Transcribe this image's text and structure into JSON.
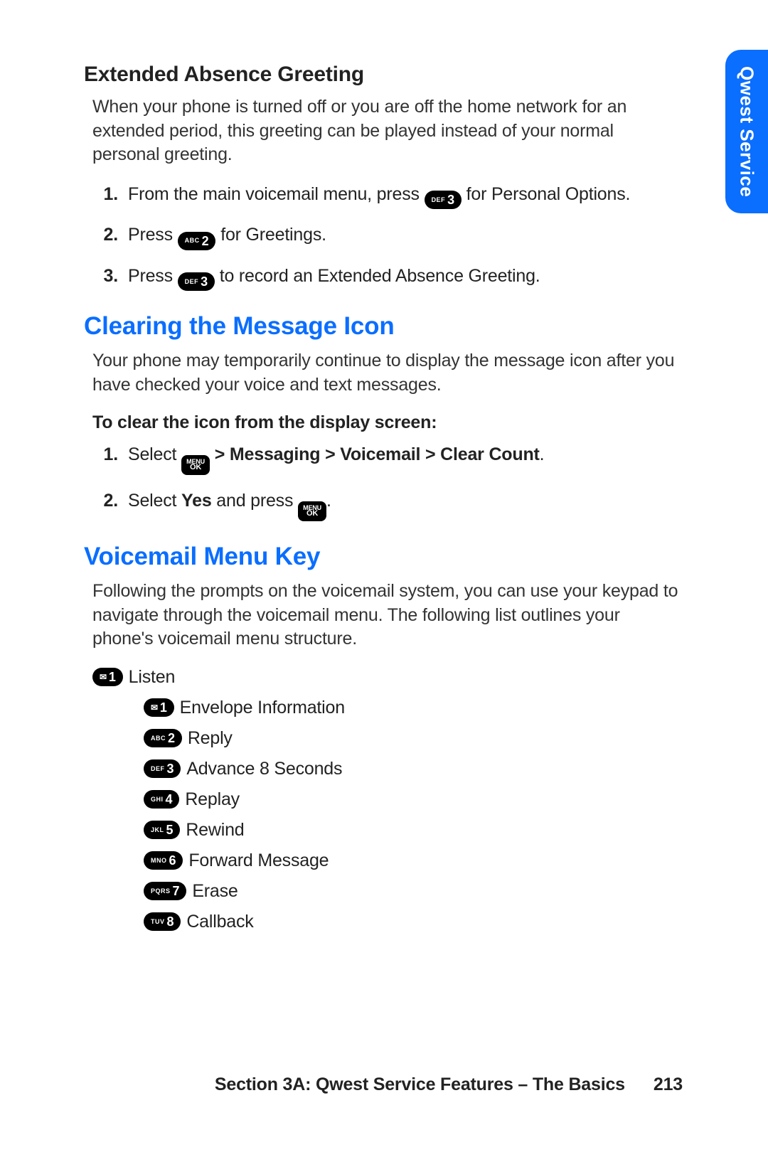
{
  "tab": "Qwest Service",
  "sections": {
    "extended": {
      "heading": "Extended Absence Greeting",
      "intro": "When your phone is turned off or you are off the home network for an extended period, this greeting can be played instead of your normal personal greeting.",
      "steps": [
        {
          "pre": "From the main voicemail menu, press ",
          "key": {
            "sm": "DEF",
            "big": "3"
          },
          "post": " for Personal Options."
        },
        {
          "pre": "Press ",
          "key": {
            "sm": "ABC",
            "big": "2"
          },
          "post": " for Greetings."
        },
        {
          "pre": "Press ",
          "key": {
            "sm": "DEF",
            "big": "3"
          },
          "post": " to record an Extended Absence Greeting."
        }
      ]
    },
    "clearing": {
      "heading": "Clearing the Message Icon",
      "intro": "Your phone may temporarily continue to display the message icon after you have checked your voice and text messages.",
      "subhead": "To clear the icon from the display screen:",
      "steps": {
        "s1_pre": "Select ",
        "s1_path": " > Messaging > Voicemail > Clear Count",
        "s1_post": ".",
        "s2_pre": "Select ",
        "s2_yes": "Yes",
        "s2_mid": " and press ",
        "s2_post": "."
      }
    },
    "menukey": {
      "heading": "Voicemail Menu Key",
      "intro": "Following the prompts on the voicemail system, you can use your keypad to navigate through the voicemail menu. The following list outlines your phone's voicemail menu structure.",
      "root": {
        "key": {
          "icon": "env",
          "big": "1"
        },
        "label": "Listen"
      },
      "sub": [
        {
          "key": {
            "icon": "env",
            "big": "1"
          },
          "label": "Envelope Information"
        },
        {
          "key": {
            "sm": "ABC",
            "big": "2"
          },
          "label": "Reply"
        },
        {
          "key": {
            "sm": "DEF",
            "big": "3"
          },
          "label": "Advance 8 Seconds"
        },
        {
          "key": {
            "sm": "GHI",
            "big": "4"
          },
          "label": "Replay"
        },
        {
          "key": {
            "sm": "JKL",
            "big": "5"
          },
          "label": "Rewind"
        },
        {
          "key": {
            "sm": "MNO",
            "big": "6"
          },
          "label": "Forward Message"
        },
        {
          "key": {
            "sm": "PQRS",
            "big": "7"
          },
          "label": "Erase"
        },
        {
          "key": {
            "sm": "TUV",
            "big": "8"
          },
          "label": "Callback"
        }
      ]
    }
  },
  "footer": {
    "title": "Section 3A: Qwest Service Features – The Basics",
    "page": "213"
  },
  "menuok": {
    "top": "MENU",
    "bottom": "OK"
  },
  "env_glyph": "✉"
}
